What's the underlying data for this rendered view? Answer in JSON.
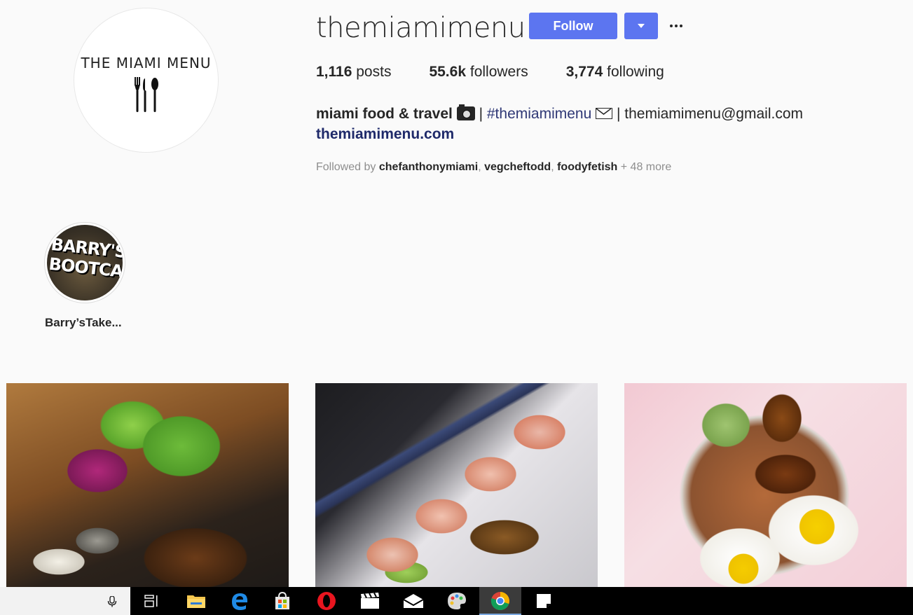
{
  "profile": {
    "logo_text": "THE MIAMI MENU",
    "username": "themiamimenu",
    "follow_label": "Follow",
    "stats": {
      "posts_count": "1,116",
      "posts_label": "posts",
      "followers_count": "55.6k",
      "followers_label": "followers",
      "following_count": "3,774",
      "following_label": "following"
    },
    "bio": {
      "name": "miami food & travel",
      "sep1": " | ",
      "hashtag": "#themiamimenu",
      "sep2": " | ",
      "email": "themiamimenu@gmail.com"
    },
    "website": "themiamimenu.com",
    "followed_by": {
      "prefix": "Followed by ",
      "users": [
        "chefanthonymiami",
        "vegcheftodd",
        "foodyfetish"
      ],
      "comma": ", ",
      "more": " + 48 more"
    }
  },
  "highlights": [
    {
      "label": "Barry’sTake...",
      "image_text": [
        "BARRY'S",
        "BOOTCAMP"
      ]
    }
  ],
  "colors": {
    "accent": "#5c75f0",
    "link": "#1f2a6a",
    "background": "#fafafa"
  },
  "posts": [
    {
      "icon": "food-photo-lettuce-bowl"
    },
    {
      "icon": "food-photo-sushi-roll"
    },
    {
      "icon": "food-photo-bodega-bowl"
    }
  ],
  "taskbar": {
    "icons": [
      "mic-icon",
      "task-view-icon",
      "file-explorer-icon",
      "edge-icon",
      "store-icon",
      "opera-icon",
      "movies-icon",
      "mail-icon",
      "paint-icon",
      "chrome-icon",
      "sticky-notes-icon"
    ]
  }
}
